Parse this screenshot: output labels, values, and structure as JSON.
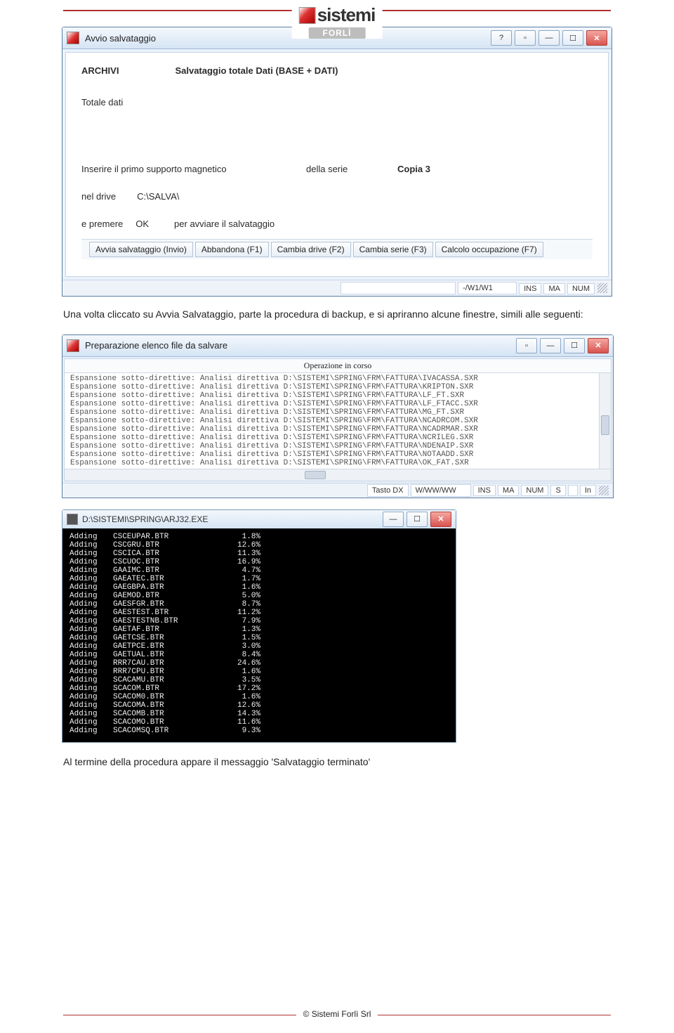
{
  "header": {
    "brand": "sistemi",
    "sub": "FORLÌ"
  },
  "dialog1": {
    "title": "Avvio salvataggio",
    "labels": {
      "archivi": "ARCHIVI",
      "subtitle": "Salvataggio totale Dati (BASE + DATI)",
      "totale": "Totale dati",
      "insert": "Inserire il primo supporto magnetico",
      "della_serie": "della serie",
      "copia": "Copia 3",
      "nel_drive": "nel drive",
      "drive_path": "C:\\SALVA\\",
      "e_premere": "e premere",
      "ok": "OK",
      "per_avviare": "per avviare il salvataggio"
    },
    "buttons": [
      "Avvia salvataggio (Invio)",
      "Abbandona (F1)",
      "Cambia drive (F2)",
      "Cambia serie (F3)",
      "Calcolo occupazione (F7)"
    ],
    "status": {
      "path": "-/W1/W1",
      "cells": [
        "INS",
        "MA",
        "NUM"
      ]
    }
  },
  "para1": "Una volta cliccato su Avvia Salvataggio, parte la procedura di backup, e si apriranno alcune finestre, simili alle seguenti:",
  "dialog2": {
    "title": "Preparazione elenco file da salvare",
    "list_header": "Operazione in corso",
    "rows": [
      "Espansione sotto-direttive: Analisi direttiva D:\\SISTEMI\\SPRING\\FRM\\FATTURA\\IVACASSA.SXR",
      "Espansione sotto-direttive: Analisi direttiva D:\\SISTEMI\\SPRING\\FRM\\FATTURA\\KRIPTON.SXR",
      "Espansione sotto-direttive: Analisi direttiva D:\\SISTEMI\\SPRING\\FRM\\FATTURA\\LF_FT.SXR",
      "Espansione sotto-direttive: Analisi direttiva D:\\SISTEMI\\SPRING\\FRM\\FATTURA\\LF_FTACC.SXR",
      "Espansione sotto-direttive: Analisi direttiva D:\\SISTEMI\\SPRING\\FRM\\FATTURA\\MG_FT.SXR",
      "Espansione sotto-direttive: Analisi direttiva D:\\SISTEMI\\SPRING\\FRM\\FATTURA\\NCADRCOM.SXR",
      "Espansione sotto-direttive: Analisi direttiva D:\\SISTEMI\\SPRING\\FRM\\FATTURA\\NCADRMAR.SXR",
      "Espansione sotto-direttive: Analisi direttiva D:\\SISTEMI\\SPRING\\FRM\\FATTURA\\NCRILEG.SXR",
      "Espansione sotto-direttive: Analisi direttiva D:\\SISTEMI\\SPRING\\FRM\\FATTURA\\NDENAIP.SXR",
      "Espansione sotto-direttive: Analisi direttiva D:\\SISTEMI\\SPRING\\FRM\\FATTURA\\NOTAADD.SXR",
      "Espansione sotto-direttive: Analisi direttiva D:\\SISTEMI\\SPRING\\FRM\\FATTURA\\OK_FAT.SXR"
    ],
    "status": {
      "left": "Tasto DX",
      "path": "W/WW/WW",
      "cells": [
        "INS",
        "MA",
        "NUM",
        "S",
        "",
        "In"
      ]
    }
  },
  "console": {
    "title": "D:\\SISTEMI\\SPRING\\ARJ32.EXE",
    "rows": [
      [
        "Adding",
        "CSCEUPAR.BTR",
        "1.8%"
      ],
      [
        "Adding",
        "CSCGRU.BTR",
        "12.6%"
      ],
      [
        "Adding",
        "CSCICA.BTR",
        "11.3%"
      ],
      [
        "Adding",
        "CSCUOC.BTR",
        "16.9%"
      ],
      [
        "Adding",
        "GAAIMC.BTR",
        "4.7%"
      ],
      [
        "Adding",
        "GAEATEC.BTR",
        "1.7%"
      ],
      [
        "Adding",
        "GAEGBPA.BTR",
        "1.6%"
      ],
      [
        "Adding",
        "GAEMOD.BTR",
        "5.0%"
      ],
      [
        "Adding",
        "GAESFGR.BTR",
        "8.7%"
      ],
      [
        "Adding",
        "GAESTEST.BTR",
        "11.2%"
      ],
      [
        "Adding",
        "GAESTESTNB.BTR",
        "7.9%"
      ],
      [
        "Adding",
        "GAETAF.BTR",
        "1.3%"
      ],
      [
        "Adding",
        "GAETCSE.BTR",
        "1.5%"
      ],
      [
        "Adding",
        "GAETPCE.BTR",
        "3.0%"
      ],
      [
        "Adding",
        "GAETUAL.BTR",
        "8.4%"
      ],
      [
        "Adding",
        "RRR7CAU.BTR",
        "24.6%"
      ],
      [
        "Adding",
        "RRR7CPU.BTR",
        "1.6%"
      ],
      [
        "Adding",
        "SCACAMU.BTR",
        "3.5%"
      ],
      [
        "Adding",
        "SCACOM.BTR",
        "17.2%"
      ],
      [
        "Adding",
        "SCACOM0.BTR",
        "1.6%"
      ],
      [
        "Adding",
        "SCACOMA.BTR",
        "12.6%"
      ],
      [
        "Adding",
        "SCACOMB.BTR",
        "14.3%"
      ],
      [
        "Adding",
        "SCACOMO.BTR",
        "11.6%"
      ],
      [
        "Adding",
        "SCACOMSQ.BTR",
        "9.3%"
      ]
    ]
  },
  "para2": "Al termine della procedura appare il messaggio 'Salvataggio terminato'",
  "footer": "© Sistemi Forlì Srl"
}
